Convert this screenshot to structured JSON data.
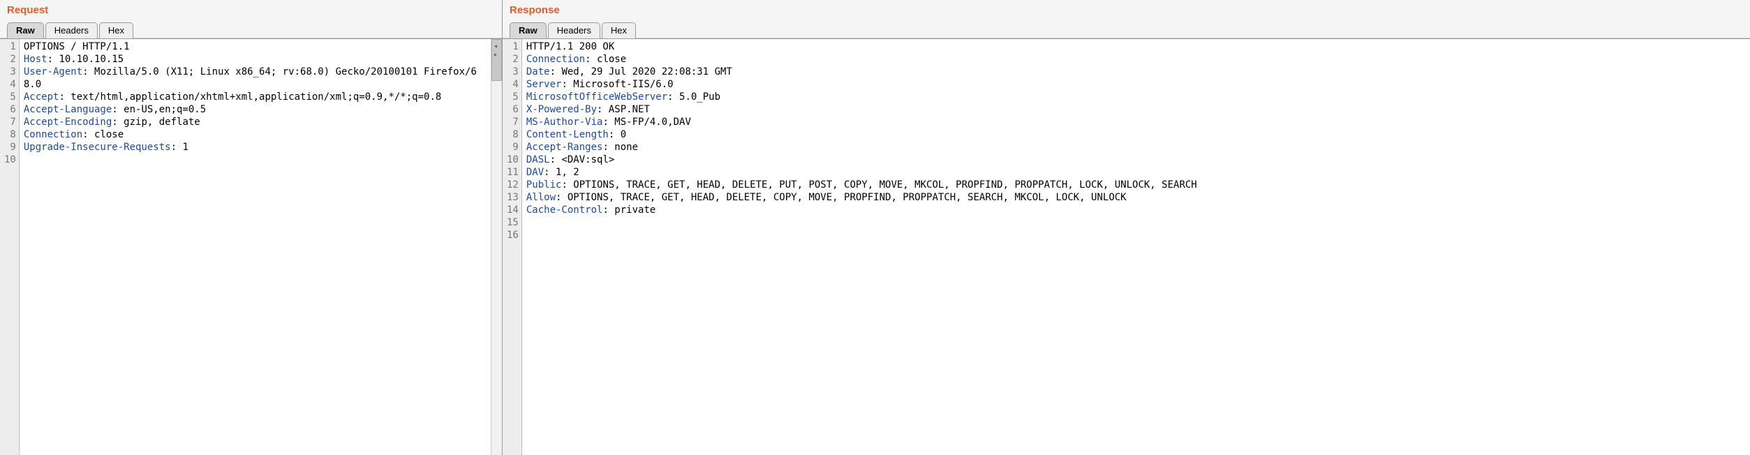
{
  "request": {
    "title": "Request",
    "tabs": {
      "raw": "Raw",
      "headers": "Headers",
      "hex": "Hex"
    },
    "lines": [
      {
        "n": 1,
        "type": "reqline",
        "text": "OPTIONS / HTTP/1.1"
      },
      {
        "n": 2,
        "type": "header",
        "key": "Host",
        "value": "10.10.10.15"
      },
      {
        "n": 3,
        "type": "header",
        "key": "User-Agent",
        "value": "Mozilla/5.0 (X11; Linux x86_64; rv:68.0) Gecko/20100101 Firefox/68.0"
      },
      {
        "n": 4,
        "type": "header",
        "key": "Accept",
        "value": "text/html,application/xhtml+xml,application/xml;q=0.9,*/*;q=0.8"
      },
      {
        "n": 5,
        "type": "header",
        "key": "Accept-Language",
        "value": "en-US,en;q=0.5"
      },
      {
        "n": 6,
        "type": "header",
        "key": "Accept-Encoding",
        "value": "gzip, deflate"
      },
      {
        "n": 7,
        "type": "header",
        "key": "Connection",
        "value": "close"
      },
      {
        "n": 8,
        "type": "header",
        "key": "Upgrade-Insecure-Requests",
        "value": "1"
      },
      {
        "n": 9,
        "type": "blank",
        "text": ""
      },
      {
        "n": 10,
        "type": "blank",
        "text": ""
      }
    ]
  },
  "response": {
    "title": "Response",
    "tabs": {
      "raw": "Raw",
      "headers": "Headers",
      "hex": "Hex"
    },
    "lines": [
      {
        "n": 1,
        "type": "statusline",
        "text": "HTTP/1.1 200 OK"
      },
      {
        "n": 2,
        "type": "header",
        "key": "Connection",
        "value": "close"
      },
      {
        "n": 3,
        "type": "header",
        "key": "Date",
        "value": "Wed, 29 Jul 2020 22:08:31 GMT"
      },
      {
        "n": 4,
        "type": "header",
        "key": "Server",
        "value": "Microsoft-IIS/6.0"
      },
      {
        "n": 5,
        "type": "header",
        "key": "MicrosoftOfficeWebServer",
        "value": "5.0_Pub"
      },
      {
        "n": 6,
        "type": "header",
        "key": "X-Powered-By",
        "value": "ASP.NET"
      },
      {
        "n": 7,
        "type": "header",
        "key": "MS-Author-Via",
        "value": "MS-FP/4.0,DAV"
      },
      {
        "n": 8,
        "type": "header",
        "key": "Content-Length",
        "value": "0"
      },
      {
        "n": 9,
        "type": "header",
        "key": "Accept-Ranges",
        "value": "none"
      },
      {
        "n": 10,
        "type": "header",
        "key": "DASL",
        "value": "<DAV:sql>"
      },
      {
        "n": 11,
        "type": "header",
        "key": "DAV",
        "value": "1, 2"
      },
      {
        "n": 12,
        "type": "header",
        "key": "Public",
        "value": "OPTIONS, TRACE, GET, HEAD, DELETE, PUT, POST, COPY, MOVE, MKCOL, PROPFIND, PROPPATCH, LOCK, UNLOCK, SEARCH"
      },
      {
        "n": 13,
        "type": "header",
        "key": "Allow",
        "value": "OPTIONS, TRACE, GET, HEAD, DELETE, COPY, MOVE, PROPFIND, PROPPATCH, SEARCH, MKCOL, LOCK, UNLOCK"
      },
      {
        "n": 14,
        "type": "header",
        "key": "Cache-Control",
        "value": "private"
      },
      {
        "n": 15,
        "type": "blank",
        "text": ""
      },
      {
        "n": 16,
        "type": "blank",
        "text": ""
      }
    ]
  }
}
